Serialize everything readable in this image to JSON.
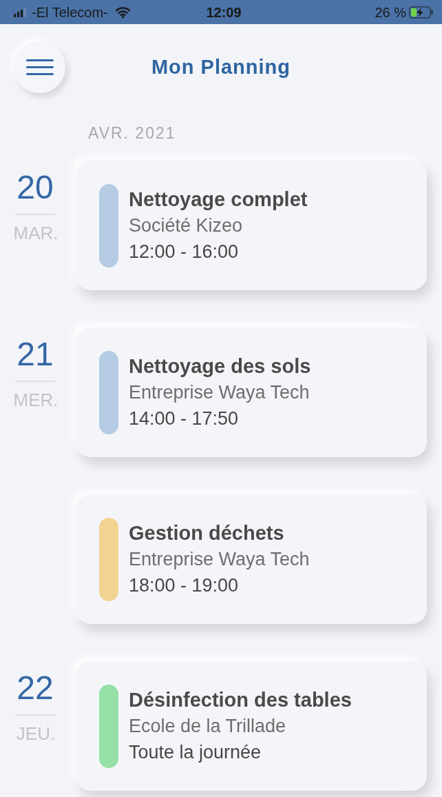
{
  "status_bar": {
    "carrier": "-El Telecom-",
    "time": "12:09",
    "battery": "26 %",
    "charging": true
  },
  "header": {
    "title": "Mon Planning"
  },
  "month": "AVR. 2021",
  "days": [
    {
      "day": "20",
      "weekday": "MAR.",
      "events": [
        {
          "title": "Nettoyage complet",
          "client": "Société Kizeo",
          "time": "12:00 - 16:00",
          "color": "#b5cce4"
        }
      ]
    },
    {
      "day": "21",
      "weekday": "MER.",
      "events": [
        {
          "title": "Nettoyage des sols",
          "client": "Entreprise Waya Tech",
          "time": "14:00 - 17:50",
          "color": "#b5cce4"
        },
        {
          "title": "Gestion déchets",
          "client": "Entreprise Waya Tech",
          "time": "18:00 - 19:00",
          "color": "#f2d391"
        }
      ]
    },
    {
      "day": "22",
      "weekday": "JEU.",
      "events": [
        {
          "title": "Désinfection des tables",
          "client": "Ecole de la Trillade",
          "time": "Toute la journée",
          "color": "#94e0a6"
        }
      ]
    }
  ]
}
